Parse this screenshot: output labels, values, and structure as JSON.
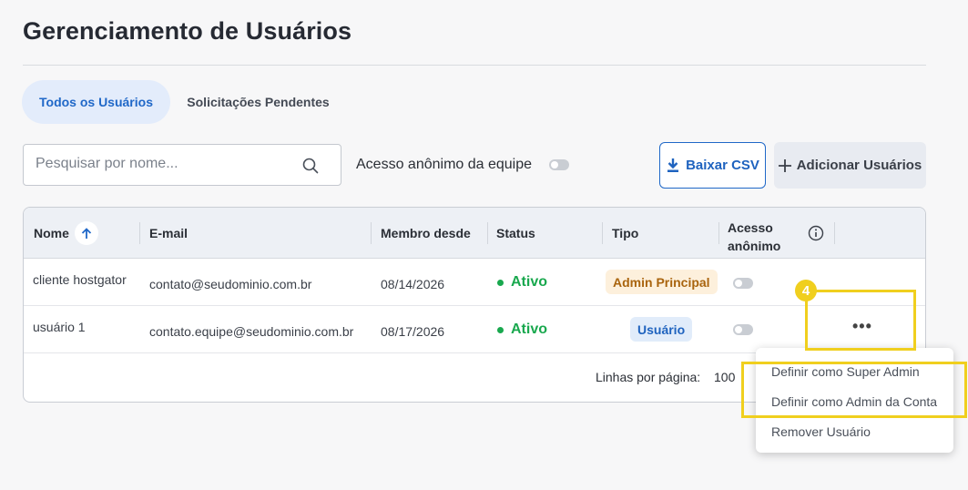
{
  "page": {
    "title": "Gerenciamento de Usuários"
  },
  "tabs": [
    {
      "label": "Todos os Usuários",
      "active": true
    },
    {
      "label": "Solicitações Pendentes",
      "active": false
    }
  ],
  "search": {
    "placeholder": "Pesquisar por nome...",
    "value": ""
  },
  "team_anonymous": {
    "label": "Acesso anônimo da equipe",
    "enabled": false
  },
  "buttons": {
    "download_csv": "Baixar CSV",
    "add_users": "Adicionar Usuários"
  },
  "table": {
    "headers": {
      "name": "Nome",
      "email": "E-mail",
      "member_since": "Membro desde",
      "status": "Status",
      "type": "Tipo",
      "anon_line1": "Acesso",
      "anon_line2": "anônimo"
    },
    "rows": [
      {
        "name": "cliente hostgator",
        "email": "contato@seudominio.com.br",
        "member_since": "08/14/2026",
        "status": "Ativo",
        "type": "Admin Principal",
        "anonymous": false
      },
      {
        "name": "usuário 1",
        "email": "contato.equipe@seudominio.com.br",
        "member_since": "08/17/2026",
        "status": "Ativo",
        "type": "Usuário",
        "anonymous": false
      }
    ],
    "footer": {
      "rows_per_page_label": "Linhas por página:",
      "rows_per_page_value": "100"
    }
  },
  "row_menu": {
    "items": [
      "Definir como Super Admin",
      "Definir como Admin da Conta",
      "Remover Usuário"
    ]
  },
  "annotation": {
    "step": "4",
    "color": "#f0cf1e"
  },
  "colors": {
    "accent": "#2068c8",
    "active_status": "#19a84e",
    "admin_badge": "#a9640e",
    "highlight": "#f0cf1e"
  }
}
